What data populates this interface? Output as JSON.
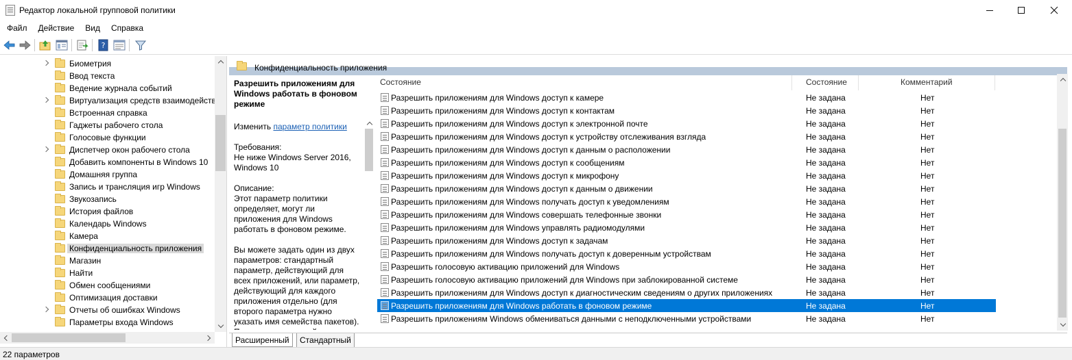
{
  "window": {
    "title": "Редактор локальной групповой политики"
  },
  "menu": {
    "items": [
      "Файл",
      "Действие",
      "Вид",
      "Справка"
    ]
  },
  "toolbar": {
    "icons": [
      "back-arrow-icon",
      "forward-arrow-icon",
      "up-folder-icon",
      "show-hide-tree-icon",
      "export-list-icon",
      "help-icon",
      "properties-view-icon",
      "filter-icon"
    ]
  },
  "tree": {
    "items": [
      {
        "label": "Биометрия",
        "expandable": true
      },
      {
        "label": "Ввод текста",
        "expandable": false
      },
      {
        "label": "Ведение журнала событий",
        "expandable": false
      },
      {
        "label": "Виртуализация средств взаимодейств",
        "expandable": true
      },
      {
        "label": "Встроенная справка",
        "expandable": false
      },
      {
        "label": "Гаджеты рабочего стола",
        "expandable": false
      },
      {
        "label": "Голосовые функции",
        "expandable": false
      },
      {
        "label": "Диспетчер окон рабочего стола",
        "expandable": true
      },
      {
        "label": "Добавить компоненты в Windows 10",
        "expandable": false
      },
      {
        "label": "Домашняя группа",
        "expandable": false
      },
      {
        "label": "Запись и трансляция игр Windows",
        "expandable": false
      },
      {
        "label": "Звукозапись",
        "expandable": false
      },
      {
        "label": "История файлов",
        "expandable": false
      },
      {
        "label": "Календарь Windows",
        "expandable": false
      },
      {
        "label": "Камера",
        "expandable": false
      },
      {
        "label": "Конфиденциальность приложения",
        "expandable": false,
        "selected": true
      },
      {
        "label": "Магазин",
        "expandable": false
      },
      {
        "label": "Найти",
        "expandable": false
      },
      {
        "label": "Обмен сообщениями",
        "expandable": false
      },
      {
        "label": "Оптимизация доставки",
        "expandable": false
      },
      {
        "label": "Отчеты об ошибках Windows",
        "expandable": true
      },
      {
        "label": "Параметры входа Windows",
        "expandable": false
      }
    ]
  },
  "header": {
    "title": "Конфиденциальность приложения"
  },
  "description": {
    "title": "Разрешить приложениям для Windows работать в фоновом режиме",
    "edit_prefix": "Изменить",
    "edit_link": "параметр политики",
    "requirements_label": "Требования:",
    "requirements_text": "Не ниже Windows Server 2016, Windows 10",
    "description_label": "Описание:",
    "description_text": "Этот параметр политики определяет, могут ли приложения для Windows работать в фоновом режиме.",
    "more_text": "Вы можете задать один из двух параметров: стандартный параметр, действующий для всех приложений, или параметр, действующий для каждого приложения отдельно (для второго параметра нужно указать имя семейства пакетов). Параметр, имя семейства"
  },
  "list": {
    "columns": {
      "name": "Состояние",
      "state": "Состояние",
      "comment": "Комментарий"
    },
    "rows": [
      {
        "name": "Разрешить приложениям для Windows доступ к камере",
        "state": "Не задана",
        "comment": "Нет"
      },
      {
        "name": "Разрешить приложениям для Windows доступ к контактам",
        "state": "Не задана",
        "comment": "Нет"
      },
      {
        "name": "Разрешить приложениям для Windows доступ к электронной почте",
        "state": "Не задана",
        "comment": "Нет"
      },
      {
        "name": "Разрешить приложениям для Windows доступ к устройству отслеживания взгляда",
        "state": "Не задана",
        "comment": "Нет"
      },
      {
        "name": "Разрешить приложениям для Windows доступ к данным о расположении",
        "state": "Не задана",
        "comment": "Нет"
      },
      {
        "name": "Разрешить приложениям для Windows доступ к сообщениям",
        "state": "Не задана",
        "comment": "Нет"
      },
      {
        "name": "Разрешить приложениям для Windows доступ к микрофону",
        "state": "Не задана",
        "comment": "Нет"
      },
      {
        "name": "Разрешить приложениям для Windows доступ к данным о движении",
        "state": "Не задана",
        "comment": "Нет"
      },
      {
        "name": "Разрешить приложениям для Windows получать доступ к уведомлениям",
        "state": "Не задана",
        "comment": "Нет"
      },
      {
        "name": "Разрешить приложениям для Windows совершать телефонные звонки",
        "state": "Не задана",
        "comment": "Нет"
      },
      {
        "name": "Разрешить приложениям для Windows управлять радиомодулями",
        "state": "Не задана",
        "comment": "Нет"
      },
      {
        "name": "Разрешить приложениям для Windows доступ к задачам",
        "state": "Не задана",
        "comment": "Нет"
      },
      {
        "name": "Разрешить приложениям для Windows получать доступ к доверенным устройствам",
        "state": "Не задана",
        "comment": "Нет"
      },
      {
        "name": "Разрешить голосовую активацию приложений для Windows",
        "state": "Не задана",
        "comment": "Нет"
      },
      {
        "name": "Разрешить голосовую активацию приложений для Windows при заблокированной системе",
        "state": "Не задана",
        "comment": "Нет"
      },
      {
        "name": "Разрешить приложениям для Windows доступ к диагностическим сведениям о других приложениях",
        "state": "Не задана",
        "comment": "Нет"
      },
      {
        "name": "Разрешить приложениям для Windows работать в фоновом режиме",
        "state": "Не задана",
        "comment": "Нет",
        "selected": true
      },
      {
        "name": "Разрешить приложениям Windows обмениваться данными с неподключенными устройствами",
        "state": "Не задана",
        "comment": "Нет"
      }
    ]
  },
  "tabs": [
    "Расширенный",
    "Стандартный"
  ],
  "status": {
    "text": "22 параметров"
  },
  "colors": {
    "selection": "#0078d7",
    "header_band": "#b9c9db",
    "folder": "#f6d67a",
    "link": "#1a5fb4"
  }
}
